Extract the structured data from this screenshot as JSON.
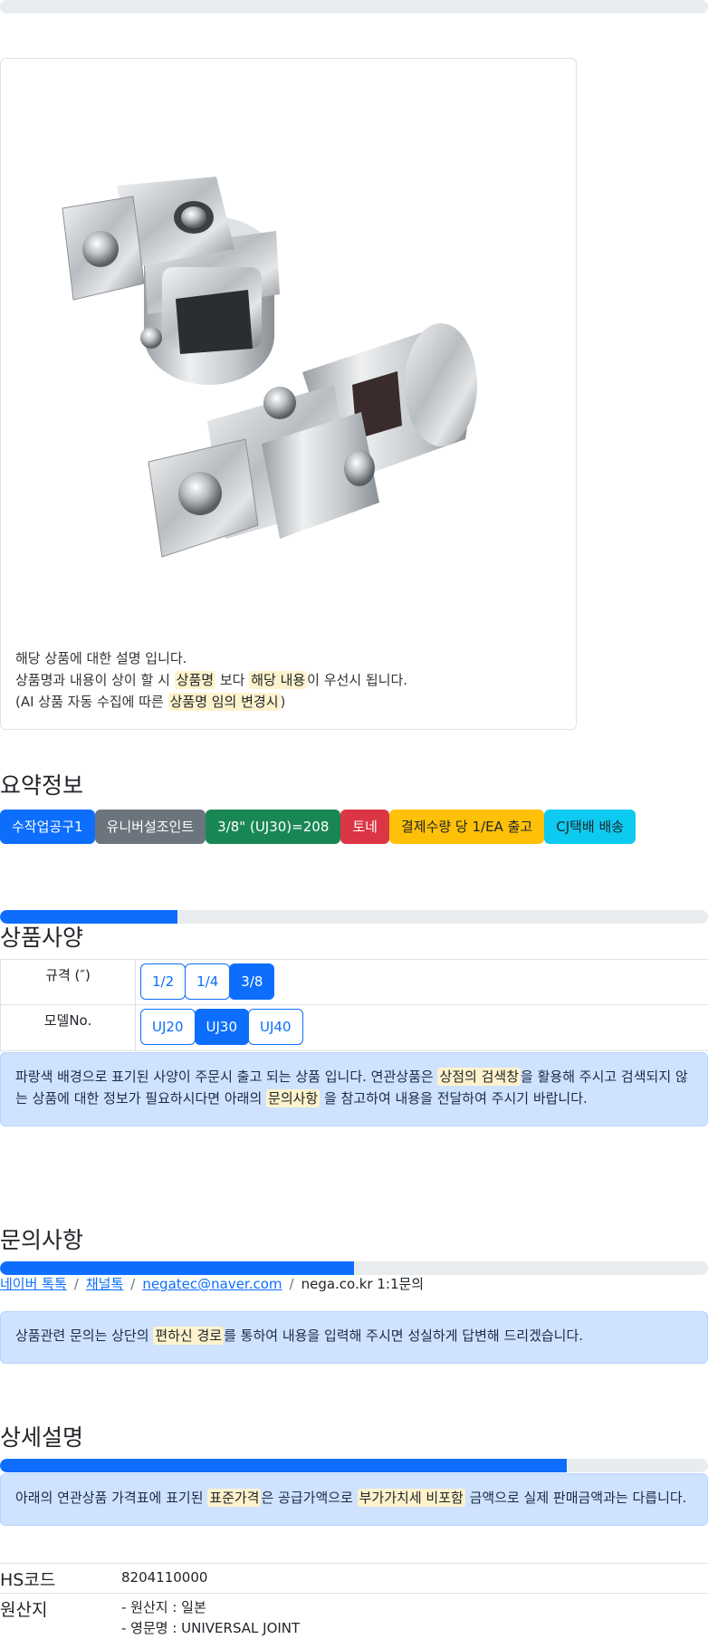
{
  "top_progress": {
    "percent": 0
  },
  "product": {
    "desc_line1": "해당 상품에 대한 설명 입니다.",
    "desc_line2_a": "상품명과 내용이 상이 할 시 ",
    "desc_line2_m1": "상품명",
    "desc_line2_b": " 보다 ",
    "desc_line2_m2": "해당 내용",
    "desc_line2_c": "이 우선시 됩니다.",
    "desc_line3_a": "(AI 상품 자동 수집에 따른 ",
    "desc_line3_m": "상품명 임의 변경시",
    "desc_line3_b": ")"
  },
  "summary": {
    "title": "요약정보",
    "badges": [
      {
        "label": "수작업공구1",
        "color": "#0d6efd",
        "text_color": "#ffffff"
      },
      {
        "label": "유니버설조인트",
        "color": "#6c757d",
        "text_color": "#ffffff"
      },
      {
        "label": "3/8\" (UJ30)=208",
        "color": "#198754",
        "text_color": "#ffffff"
      },
      {
        "label": "토네",
        "color": "#dc3545",
        "text_color": "#ffffff"
      },
      {
        "label": "결제수량 당 1/EA 출고",
        "color": "#ffc107",
        "text_color": "#212529"
      },
      {
        "label": "CJ택배 배송",
        "color": "#0dcaf0",
        "text_color": "#212529"
      }
    ]
  },
  "spec": {
    "progress_percent": 25,
    "title": "상품사양",
    "rows": [
      {
        "label": "규격 (″)",
        "options": [
          {
            "label": "1/2",
            "active": false
          },
          {
            "label": "1/4",
            "active": false
          },
          {
            "label": "3/8",
            "active": true
          }
        ]
      },
      {
        "label": "모델No.",
        "options": [
          {
            "label": "UJ20",
            "active": false
          },
          {
            "label": "UJ30",
            "active": true
          },
          {
            "label": "UJ40",
            "active": false
          }
        ]
      }
    ],
    "notice_a": "파랑색 배경으로 표기된 사양이 주문시 출고 되는 상품 입니다. 연관상품은 ",
    "notice_m1": "상점의 검색창",
    "notice_b": "을 활용해 주시고 검색되지 않는 상품에 대한 정보가 필요하시다면 아래의 ",
    "notice_m2": "문의사항",
    "notice_c": " 을 참고하여 내용을 전달하여 주시기 바랍니다."
  },
  "inquiry": {
    "title": "문의사항",
    "progress_percent": 50,
    "links": [
      "네이버 톡톡",
      "채널톡",
      "negatec@naver.com"
    ],
    "plain": "nega.co.kr 1:1문의",
    "notice_a": "상품관련 문의는 상단의 ",
    "notice_m": "편하신 경로",
    "notice_b": "를 통하여 내용을 입력해 주시면 성실하게 답변해 드리겠습니다."
  },
  "detail": {
    "title": "상세설명",
    "progress_percent": 80,
    "notice_a": "아래의 연관상품 가격표에 표기된 ",
    "notice_m1": "표준가격",
    "notice_b": "은 공급가액으로 ",
    "notice_m2": "부가가치세 비포함",
    "notice_c": " 금액으로 실제 판매금액과는 다릅니다.",
    "hs_label": "HS코드",
    "hs_value": "8204110000",
    "origin_label": "원산지",
    "origin_line1": "- 원산지 : 일본",
    "origin_line2": "- 영문명 : UNIVERSAL JOINT"
  }
}
